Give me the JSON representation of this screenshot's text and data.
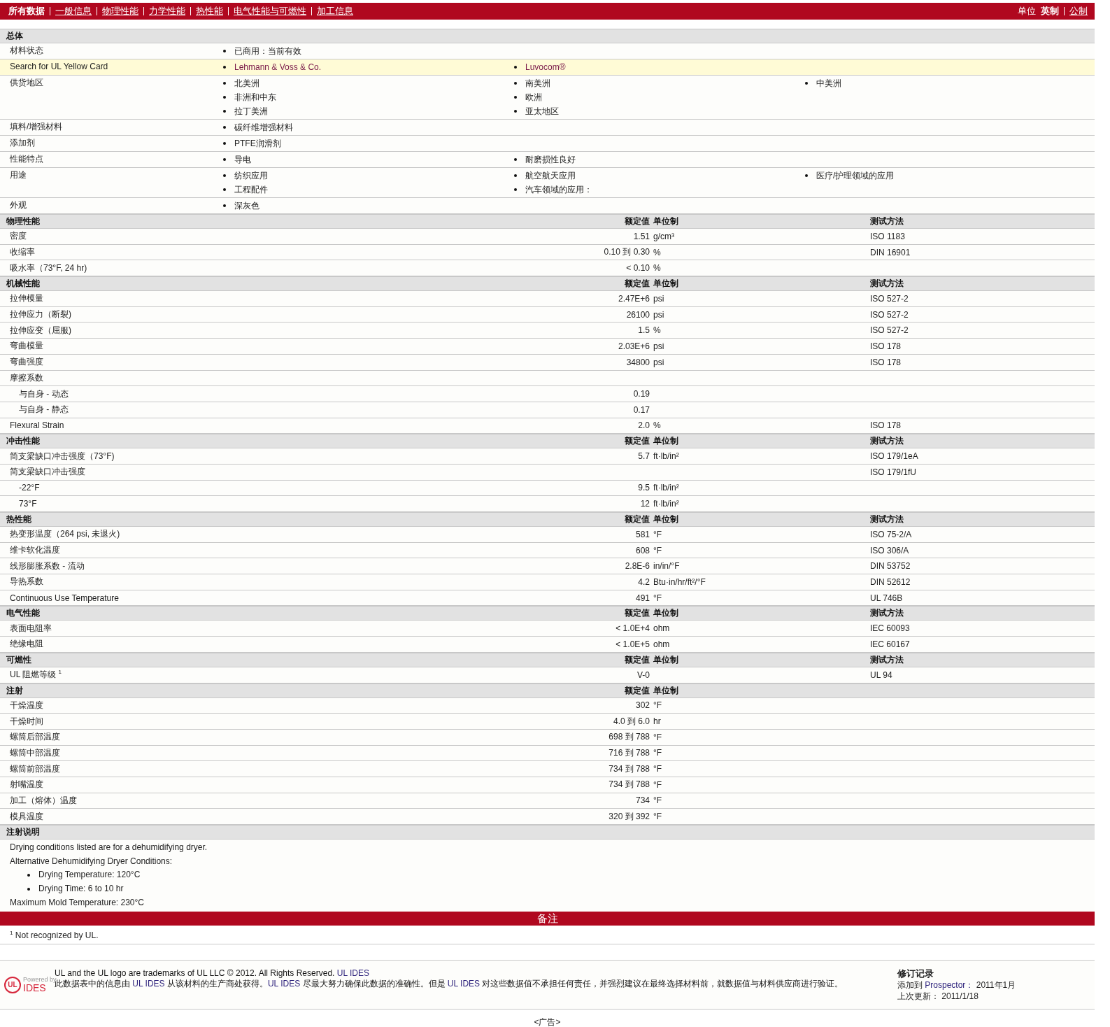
{
  "nav": {
    "links": [
      {
        "label": "所有数据",
        "selected": true
      },
      {
        "label": "一般信息",
        "selected": false
      },
      {
        "label": "物理性能",
        "selected": false
      },
      {
        "label": "力学性能",
        "selected": false
      },
      {
        "label": "热性能",
        "selected": false
      },
      {
        "label": "电气性能与可燃性",
        "selected": false
      },
      {
        "label": "加工信息",
        "selected": false
      }
    ],
    "unit_label": "单位",
    "units": [
      {
        "label": "英制",
        "selected": true
      },
      {
        "label": "公制",
        "selected": false
      }
    ]
  },
  "general": {
    "title": "总体",
    "rows": [
      {
        "label": "材料状态",
        "highlighted": false,
        "link": false,
        "columns": [
          [
            "已商用：当前有效"
          ]
        ]
      },
      {
        "label": "Search for UL Yellow Card",
        "highlighted": true,
        "link": true,
        "columns": [
          [
            "Lehmann & Voss & Co."
          ],
          [
            "Luvocom®"
          ]
        ]
      },
      {
        "label": "供货地区",
        "highlighted": false,
        "link": false,
        "columns": [
          [
            "北美洲",
            "非洲和中东",
            "拉丁美洲"
          ],
          [
            "南美洲",
            "欧洲",
            "亚太地区"
          ],
          [
            "中美洲"
          ]
        ]
      },
      {
        "label": "填料/增强材料",
        "highlighted": false,
        "link": false,
        "columns": [
          [
            "碳纤维增强材料"
          ]
        ]
      },
      {
        "label": "添加剂",
        "highlighted": false,
        "link": false,
        "columns": [
          [
            "PTFE润滑剂"
          ]
        ]
      },
      {
        "label": "性能特点",
        "highlighted": false,
        "link": false,
        "columns": [
          [
            "导电"
          ],
          [
            "耐磨损性良好"
          ]
        ]
      },
      {
        "label": "用途",
        "highlighted": false,
        "link": false,
        "columns": [
          [
            "纺织应用",
            "工程配件"
          ],
          [
            "航空航天应用",
            "汽车领域的应用："
          ],
          [
            "医疗/护理领域的应用"
          ]
        ]
      },
      {
        "label": "外观",
        "highlighted": false,
        "link": false,
        "columns": [
          [
            "深灰色"
          ]
        ]
      }
    ]
  },
  "sections": [
    {
      "title": "物理性能",
      "value_header": "额定值",
      "unit_header": "单位制",
      "method_header": "测试方法",
      "rows": [
        {
          "label": "密度",
          "value": "1.51",
          "unit": "g/cm³",
          "method": "ISO 1183"
        },
        {
          "label": "收缩率",
          "value": "0.10 到  0.30",
          "unit": "%",
          "method": "DIN 16901"
        },
        {
          "label": "吸水率（73°F, 24 hr)",
          "value": "< 0.10",
          "unit": "%"
        }
      ]
    },
    {
      "title": "机械性能",
      "value_header": "额定值",
      "unit_header": "单位制",
      "method_header": "测试方法",
      "rows": [
        {
          "label": "拉伸模量",
          "value": "2.47E+6",
          "unit": "psi",
          "method": "ISO 527-2"
        },
        {
          "label": "拉伸应力（断裂)",
          "value": "26100",
          "unit": "psi",
          "method": "ISO 527-2"
        },
        {
          "label": "拉伸应变（屈服)",
          "value": "1.5",
          "unit": "%",
          "method": "ISO 527-2"
        },
        {
          "label": "弯曲模量",
          "value": "2.03E+6",
          "unit": "psi",
          "method": "ISO 178"
        },
        {
          "label": "弯曲强度",
          "value": "34800",
          "unit": "psi",
          "method": "ISO 178"
        },
        {
          "label": "摩擦系数",
          "children": [
            {
              "label": "与自身  - 动态",
              "value": "0.19"
            },
            {
              "label": "与自身  - 静态",
              "value": "0.17"
            }
          ]
        },
        {
          "label": "Flexural Strain",
          "value": "2.0",
          "unit": "%",
          "method": "ISO 178"
        }
      ]
    },
    {
      "title": "冲击性能",
      "value_header": "额定值",
      "unit_header": "单位制",
      "method_header": "测试方法",
      "rows": [
        {
          "label": "简支梁缺口冲击强度（73°F)",
          "value": "5.7",
          "unit": "ft·lb/in²",
          "method": "ISO 179/1eA"
        },
        {
          "label": "简支梁缺口冲击强度",
          "method": "ISO 179/1fU",
          "children": [
            {
              "label": "-22°F",
              "value": "9.5",
              "unit": "ft·lb/in²"
            },
            {
              "label": "73°F",
              "value": "12",
              "unit": "ft·lb/in²"
            }
          ]
        }
      ]
    },
    {
      "title": "热性能",
      "value_header": "额定值",
      "unit_header": "单位制",
      "method_header": "测试方法",
      "rows": [
        {
          "label": "热变形温度（264 psi, 未退火)",
          "value": "581",
          "unit": "°F",
          "method": "ISO 75-2/A"
        },
        {
          "label": "维卡软化温度",
          "value": "608",
          "unit": "°F",
          "method": "ISO 306/A"
        },
        {
          "label": "线形膨胀系数  - 流动",
          "value": "2.8E-6",
          "unit": "in/in/°F",
          "method": "DIN 53752"
        },
        {
          "label": "导热系数",
          "value": "4.2",
          "unit": "Btu·in/hr/ft²/°F",
          "method": "DIN 52612"
        },
        {
          "label": "Continuous Use Temperature",
          "value": "491",
          "unit": "°F",
          "method": "UL 746B"
        }
      ]
    },
    {
      "title": "电气性能",
      "value_header": "额定值",
      "unit_header": "单位制",
      "method_header": "测试方法",
      "rows": [
        {
          "label": "表面电阻率",
          "value": "< 1.0E+4",
          "unit": "ohm",
          "method": "IEC 60093"
        },
        {
          "label": "绝缘电阻",
          "value": "< 1.0E+5",
          "unit": "ohm",
          "method": "IEC 60167"
        }
      ]
    },
    {
      "title": "可燃性",
      "value_header": "额定值",
      "unit_header": "单位制",
      "method_header": "测试方法",
      "rows": [
        {
          "label": "UL 阻燃等级 $^{1}$",
          "value": "V-0",
          "method": "UL 94"
        }
      ]
    },
    {
      "title": "注射",
      "value_header": "额定值",
      "unit_header": "单位制",
      "rows": [
        {
          "label": "干燥温度",
          "value": "302",
          "unit": "°F"
        },
        {
          "label": "干燥时间",
          "value": "4.0 到  6.0",
          "unit": "hr"
        },
        {
          "label": "螺筒后部温度",
          "value": "698 到  788",
          "unit": "°F"
        },
        {
          "label": "螺筒中部温度",
          "value": "716 到  788",
          "unit": "°F"
        },
        {
          "label": "螺筒前部温度",
          "value": "734 到  788",
          "unit": "°F"
        },
        {
          "label": "射嘴温度",
          "value": "734 到  788",
          "unit": "°F"
        },
        {
          "label": "加工（熔体）温度",
          "value": "734",
          "unit": "°F"
        },
        {
          "label": "模具温度",
          "value": "320 到  392",
          "unit": "°F"
        }
      ]
    }
  ],
  "notes": {
    "title": "注射说明",
    "lines": [
      {
        "kind": "text",
        "text": "Drying conditions listed are for a dehumidifying dryer."
      },
      {
        "kind": "text",
        "text": "Alternative Dehumidifying Dryer Conditions:"
      },
      {
        "kind": "bullet",
        "text": "Drying Temperature: 120°C"
      },
      {
        "kind": "bullet",
        "text": "Drying Time: 6 to 10 hr"
      },
      {
        "kind": "text",
        "text": "Maximum Mold Temperature: 230°C"
      }
    ]
  },
  "remarks": {
    "title": "备注",
    "footnotes": [
      "$^{1}$ Not recognized by UL."
    ]
  },
  "footer": {
    "logo": {
      "mark": "UL",
      "powered_by": "Powered by",
      "brand": "IDES"
    },
    "trademark": [
      {
        "text": "UL and the UL logo are trademarks of UL LLC © 2012. All Rights Reserved. ",
        "kind": "text"
      },
      {
        "text": "UL IDES",
        "kind": "link"
      }
    ],
    "disclaimer": [
      {
        "text": "此数据表中的信息由 ",
        "kind": "text"
      },
      {
        "text": "UL IDES",
        "kind": "link"
      },
      {
        "text": " 从该材料的生产商处获得。",
        "kind": "text"
      },
      {
        "text": "UL IDES",
        "kind": "link"
      },
      {
        "text": " 尽最大努力确保此数据的准确性。但是 ",
        "kind": "text"
      },
      {
        "text": "UL IDES",
        "kind": "link"
      },
      {
        "text": " 对这些数据值不承担任何责任，并强烈建议在最终选择材料前，就数据值与材料供应商进行验证。",
        "kind": "text"
      }
    ],
    "revision": {
      "title": "修订记录",
      "lines": [
        [
          {
            "text": "添加到 ",
            "kind": "text"
          },
          {
            "text": "Prospector：",
            "kind": "link"
          },
          {
            "text": "2011年1月",
            "kind": "text"
          }
        ],
        [
          {
            "text": "上次更新：",
            "kind": "text"
          },
          {
            "text": "2011/1/18",
            "kind": "text"
          }
        ]
      ]
    }
  },
  "ad": "<广告>"
}
